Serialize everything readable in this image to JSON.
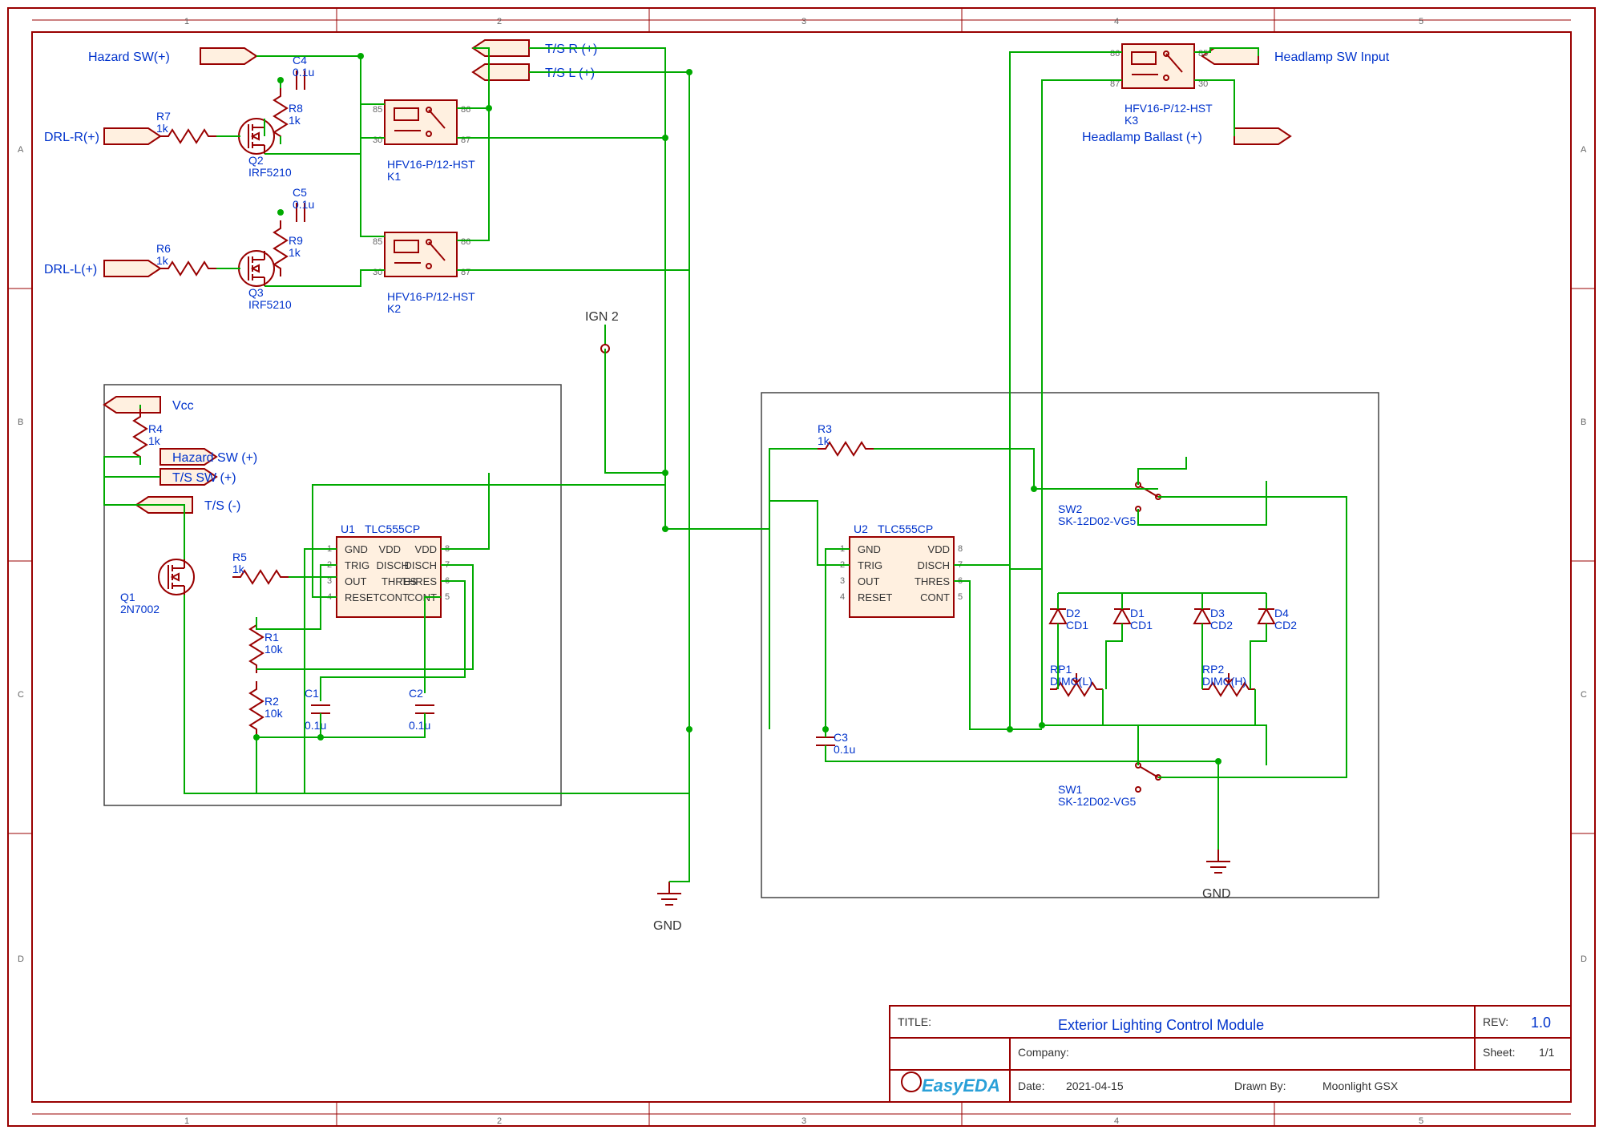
{
  "sheet": {
    "title_label": "TITLE:",
    "title": "Exterior Lighting Control Module",
    "rev_label": "REV:",
    "rev": "1.0",
    "company_label": "Company:",
    "date_label": "Date:",
    "date": "2021-04-15",
    "drawn_label": "Drawn By:",
    "drawn": "Moonlight GSX",
    "sheet_label": "Sheet:",
    "sheet": "1/1",
    "tool": "EasyEDA"
  },
  "ruler": {
    "cols": [
      "1",
      "2",
      "3",
      "4",
      "5"
    ],
    "rows": [
      "A",
      "B",
      "C",
      "D"
    ]
  },
  "ports": {
    "hazard_top": "Hazard SW(+)",
    "drl_r": "DRL-R(+)",
    "drl_l": "DRL-L(+)",
    "ts_r": "T/S R (+)",
    "ts_l": "T/S L (+)",
    "headlamp_in": "Headlamp SW Input",
    "headlamp_ball": "Headlamp Ballast (+)",
    "vcc": "Vcc",
    "hazard_sw": "Hazard SW (+)",
    "ts_sw": "T/S SW (+)",
    "ts_neg": "T/S (-)"
  },
  "labels": {
    "ign2": "IGN 2",
    "gnd": "GND"
  },
  "components": {
    "C1": {
      "ref": "C1",
      "val": "0.1u"
    },
    "C2": {
      "ref": "C2",
      "val": "0.1u"
    },
    "C3": {
      "ref": "C3",
      "val": "0.1u"
    },
    "C4": {
      "ref": "C4",
      "val": "0.1u"
    },
    "C5": {
      "ref": "C5",
      "val": "0.1u"
    },
    "R1": {
      "ref": "R1",
      "val": "10k"
    },
    "R2": {
      "ref": "R2",
      "val": "10k"
    },
    "R3": {
      "ref": "R3",
      "val": "1k"
    },
    "R4": {
      "ref": "R4",
      "val": "1k"
    },
    "R5": {
      "ref": "R5",
      "val": "1k"
    },
    "R6": {
      "ref": "R6",
      "val": "1k"
    },
    "R7": {
      "ref": "R7",
      "val": "1k"
    },
    "R8": {
      "ref": "R8",
      "val": "1k"
    },
    "R9": {
      "ref": "R9",
      "val": "1k"
    },
    "RP1": {
      "ref": "RP1",
      "val": "DIMC(L)"
    },
    "RP2": {
      "ref": "RP2",
      "val": "DIMC(H)"
    },
    "Q1": {
      "ref": "Q1",
      "val": "2N7002"
    },
    "Q2": {
      "ref": "Q2",
      "val": "IRF5210"
    },
    "Q3": {
      "ref": "Q3",
      "val": "IRF5210"
    },
    "U1": {
      "ref": "U1",
      "val": "TLC555CP"
    },
    "U2": {
      "ref": "U2",
      "val": "TLC555CP"
    },
    "K1": {
      "ref": "K1",
      "val": "HFV16-P/12-HST"
    },
    "K2": {
      "ref": "K2",
      "val": "HFV16-P/12-HST"
    },
    "K3": {
      "ref": "K3",
      "val": "HFV16-P/12-HST"
    },
    "D1": {
      "ref": "D1",
      "val": "CD1"
    },
    "D2": {
      "ref": "D2",
      "val": "CD1"
    },
    "D3": {
      "ref": "D3",
      "val": "CD2"
    },
    "D4": {
      "ref": "D4",
      "val": "CD2"
    },
    "SW1": {
      "ref": "SW1",
      "val": "SK-12D02-VG5"
    },
    "SW2": {
      "ref": "SW2",
      "val": "SK-12D02-VG5"
    }
  },
  "pins555": {
    "p1": "GND",
    "p2": "TRIG",
    "p3": "OUT",
    "p4": "RESET",
    "p5": "CONT",
    "p6": "THRES",
    "p7": "DISCH",
    "p8": "VDD",
    "n1": "1",
    "n2": "2",
    "n3": "3",
    "n4": "4",
    "n5": "5",
    "n6": "6",
    "n7": "7",
    "n8": "8"
  },
  "relaypins": {
    "p85": "85",
    "p86": "86",
    "p30": "30",
    "p87": "87"
  }
}
